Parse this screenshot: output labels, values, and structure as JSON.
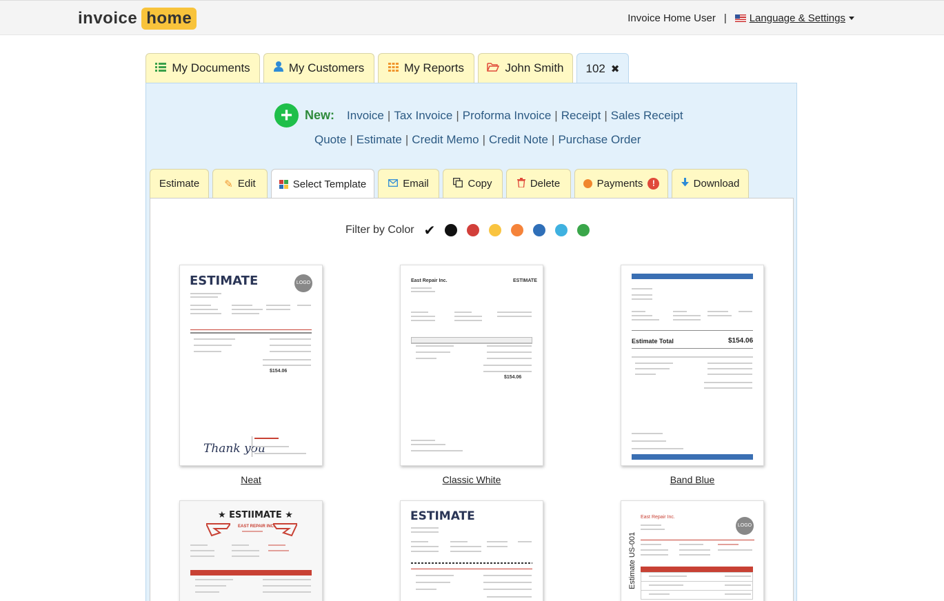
{
  "header": {
    "logo_left": "invoice",
    "logo_right": "home",
    "user": "Invoice Home User",
    "separator": "|",
    "language": "Language & Settings"
  },
  "main_tabs": [
    {
      "label": "My Documents",
      "icon": "list-icon"
    },
    {
      "label": "My Customers",
      "icon": "user-icon"
    },
    {
      "label": "My Reports",
      "icon": "grid-icon"
    },
    {
      "label": "John Smith",
      "icon": "folder-open-icon"
    },
    {
      "label": "102",
      "icon": "close-icon",
      "close_glyph": "✖"
    }
  ],
  "new_section": {
    "plus_glyph": "+",
    "label": "New:",
    "row1": [
      "Invoice",
      "Tax Invoice",
      "Proforma Invoice",
      "Receipt",
      "Sales Receipt"
    ],
    "row2": [
      "Quote",
      "Estimate",
      "Credit Memo",
      "Credit Note",
      "Purchase Order"
    ],
    "pipe": "|"
  },
  "sub_tabs": [
    {
      "label": "Estimate"
    },
    {
      "label": "Edit",
      "icon": "pencil-icon"
    },
    {
      "label": "Select Template",
      "icon": "template-grid-icon"
    },
    {
      "label": "Email",
      "icon": "envelope-icon"
    },
    {
      "label": "Copy",
      "icon": "copy-icon"
    },
    {
      "label": "Delete",
      "icon": "trash-icon"
    },
    {
      "label": "Payments",
      "icon": "alert-icon",
      "alert_glyph": "!"
    },
    {
      "label": "Download",
      "icon": "arrow-down-icon"
    }
  ],
  "filter": {
    "label": "Filter by Color",
    "check_glyph": "✔",
    "colors": [
      "#111111",
      "#d23f3a",
      "#f9c440",
      "#f5833a",
      "#2f6fb8",
      "#3fb1e0",
      "#3aa64a"
    ]
  },
  "templates": [
    {
      "name": "Neat",
      "title": "ESTIMATE",
      "logo": "LOGO",
      "total": "$154.06",
      "footer": "Thank you"
    },
    {
      "name": "Classic White",
      "company": "East Repair Inc.",
      "title": "ESTIMATE",
      "total": "$154.06"
    },
    {
      "name": "Band Blue",
      "total_label": "Estimate Total",
      "total": "$154.06"
    },
    {
      "name": "",
      "title": "★ ESTIIMATE ★",
      "company": "EAST REPAIR INC."
    },
    {
      "name": "",
      "title": "ESTIMATE"
    },
    {
      "name": "",
      "company": "East Repair Inc.",
      "logo": "LOGO",
      "side_title": "Estimate US-001"
    }
  ],
  "colors": {
    "tab_yellow": "#fff9c4",
    "panel_blue": "#e3f1fb",
    "link_blue": "#2c5a83",
    "new_green": "#2e8a3a"
  }
}
